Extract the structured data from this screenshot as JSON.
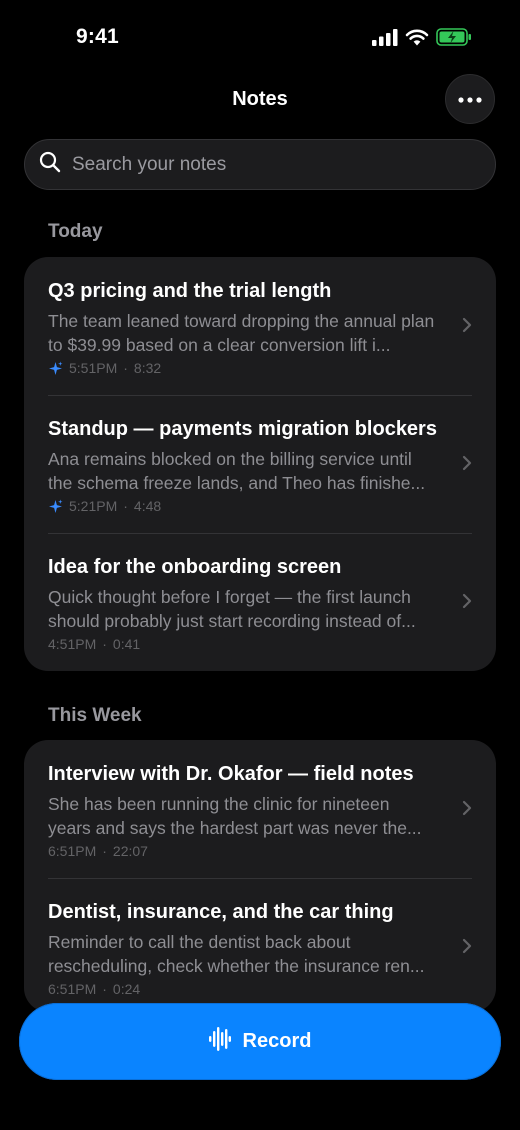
{
  "status_bar": {
    "time": "9:41"
  },
  "header": {
    "title": "Notes"
  },
  "search": {
    "placeholder": "Search your notes",
    "value": ""
  },
  "sections": [
    {
      "title": "Today",
      "notes": [
        {
          "title": "Q3 pricing and the trial length",
          "preview": "The team leaned toward dropping the annual plan to $39.99 based on a clear conversion lift i...",
          "time": "5:51PM",
          "duration": "8:32",
          "ai": true
        },
        {
          "title": "Standup — payments migration blockers",
          "preview": "Ana remains blocked on the billing service until the schema freeze lands, and Theo has finishe...",
          "time": "5:21PM",
          "duration": "4:48",
          "ai": true
        },
        {
          "title": "Idea for the onboarding screen",
          "preview": "Quick thought before I forget — the first launch should probably just start recording instead of...",
          "time": "4:51PM",
          "duration": "0:41",
          "ai": false
        }
      ]
    },
    {
      "title": "This Week",
      "notes": [
        {
          "title": "Interview with Dr. Okafor — field notes",
          "preview": "She has been running the clinic for nineteen years and says the hardest part was never the...",
          "time": "6:51PM",
          "duration": "22:07",
          "ai": false
        },
        {
          "title": "Dentist, insurance, and the car thing",
          "preview": "Reminder to call the dentist back about rescheduling, check whether the insurance ren...",
          "time": "6:51PM",
          "duration": "0:24",
          "ai": false
        }
      ]
    }
  ],
  "record_button": {
    "label": "Record"
  },
  "icons": {
    "more": "ellipsis-icon",
    "search": "search-icon",
    "chevron": "chevron-right-icon",
    "ai": "sparkle-icon",
    "record": "waveform-icon"
  },
  "colors": {
    "accent": "#0a84ff",
    "ai_sparkle": "#3a8cff",
    "battery": "#34c759"
  }
}
